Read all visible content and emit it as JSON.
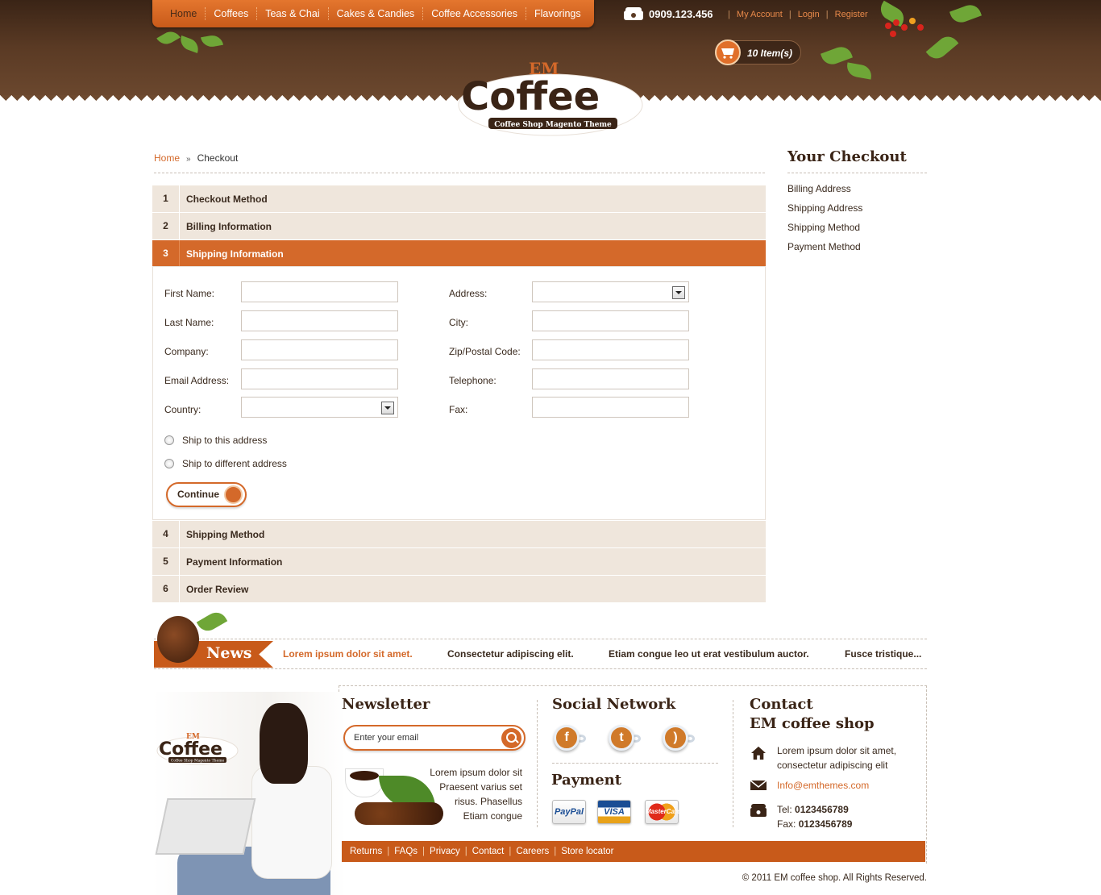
{
  "nav": {
    "items": [
      "Home",
      "Coffees",
      "Teas & Chai",
      "Cakes & Candies",
      "Coffee Accessories",
      "Flavorings"
    ],
    "active_index": 0
  },
  "header": {
    "phone": "0909.123.456",
    "links": [
      "My Account",
      "Login",
      "Register"
    ],
    "cart_label": "10 Item(s)"
  },
  "logo": {
    "top_text": "EM",
    "main_text": "Coffee",
    "tagline": "Coffee Shop Magento Theme"
  },
  "breadcrumb": {
    "home": "Home",
    "separator": "»",
    "current": "Checkout"
  },
  "steps": [
    {
      "num": "1",
      "label": "Checkout Method"
    },
    {
      "num": "2",
      "label": "Billing Information"
    },
    {
      "num": "3",
      "label": "Shipping Information"
    },
    {
      "num": "4",
      "label": "Shipping Method"
    },
    {
      "num": "5",
      "label": "Payment Information"
    },
    {
      "num": "6",
      "label": "Order Review"
    }
  ],
  "form": {
    "left": [
      "First Name:",
      "Last Name:",
      "Company:",
      "Email Address:",
      "Country:"
    ],
    "right": [
      "Address:",
      "City:",
      "Zip/Postal Code:",
      "Telephone:",
      "Fax:"
    ],
    "ship_options": [
      "Ship to this address",
      "Ship to different address"
    ],
    "continue_label": "Continue"
  },
  "sidebar": {
    "title": "Your Checkout",
    "items": [
      "Billing Address",
      "Shipping Address",
      "Shipping Method",
      "Payment Method"
    ]
  },
  "news": {
    "label": "News",
    "items": [
      "Lorem ipsum dolor sit amet.",
      "Consectetur adipiscing elit.",
      "Etiam congue leo ut erat vestibulum auctor.",
      "Fusce tristique..."
    ]
  },
  "footer": {
    "newsletter_title": "Newsletter",
    "newsletter_placeholder": "Enter your email",
    "newsletter_text": [
      "Lorem ipsum dolor sit",
      "Praesent varius set",
      "risus. Phasellus",
      "Etiam congue"
    ],
    "social_title": "Social Network",
    "social_icons": [
      "facebook-icon",
      "twitter-icon",
      "rss-icon"
    ],
    "payment_title": "Payment",
    "payment_methods": [
      "PayPal",
      "VISA",
      "MasterCard"
    ],
    "contact_title_1": "Contact",
    "contact_title_2": "EM coffee shop",
    "address_line_1": "Lorem ipsum dolor sit amet,",
    "address_line_2": "consectetur adipiscing elit",
    "email": "Info@emthemes.com",
    "tel_label": "Tel:",
    "tel": "0123456789",
    "fax_label": "Fax:",
    "fax": "0123456789",
    "links": [
      "Returns",
      "FAQs",
      "Privacy",
      "Contact",
      "Careers",
      "Store locator"
    ],
    "copyright": "© 2011 EM coffee shop. All Rights Reserved."
  },
  "colors": {
    "accent": "#d4692a",
    "header_brown": "#5a3a24",
    "step_bg": "#efe6dc",
    "leaf_green": "#6fa637"
  }
}
